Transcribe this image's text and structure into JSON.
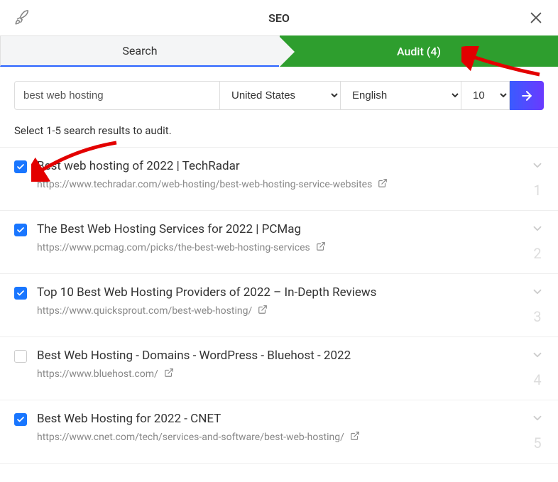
{
  "header": {
    "title": "SEO"
  },
  "tabs": {
    "search": "Search",
    "audit": "Audit (4)"
  },
  "controls": {
    "query": "best web hosting",
    "country": "United States",
    "language": "English",
    "count": "10"
  },
  "instruction": "Select 1-5 search results to audit.",
  "results": [
    {
      "checked": true,
      "title": "Best web hosting of 2022 | TechRadar",
      "url": "https://www.techradar.com/web-hosting/best-web-hosting-service-websites",
      "rank": "1"
    },
    {
      "checked": true,
      "title": "The Best Web Hosting Services for 2022 | PCMag",
      "url": "https://www.pcmag.com/picks/the-best-web-hosting-services",
      "rank": "2"
    },
    {
      "checked": true,
      "title": "Top 10 Best Web Hosting Providers of 2022 – In-Depth Reviews",
      "url": "https://www.quicksprout.com/best-web-hosting/",
      "rank": "3"
    },
    {
      "checked": false,
      "title": "Best Web Hosting - Domains - WordPress - Bluehost - 2022",
      "url": "https://www.bluehost.com/",
      "rank": "4"
    },
    {
      "checked": true,
      "title": "Best Web Hosting for 2022 - CNET",
      "url": "https://www.cnet.com/tech/services-and-software/best-web-hosting/",
      "rank": "5"
    }
  ]
}
